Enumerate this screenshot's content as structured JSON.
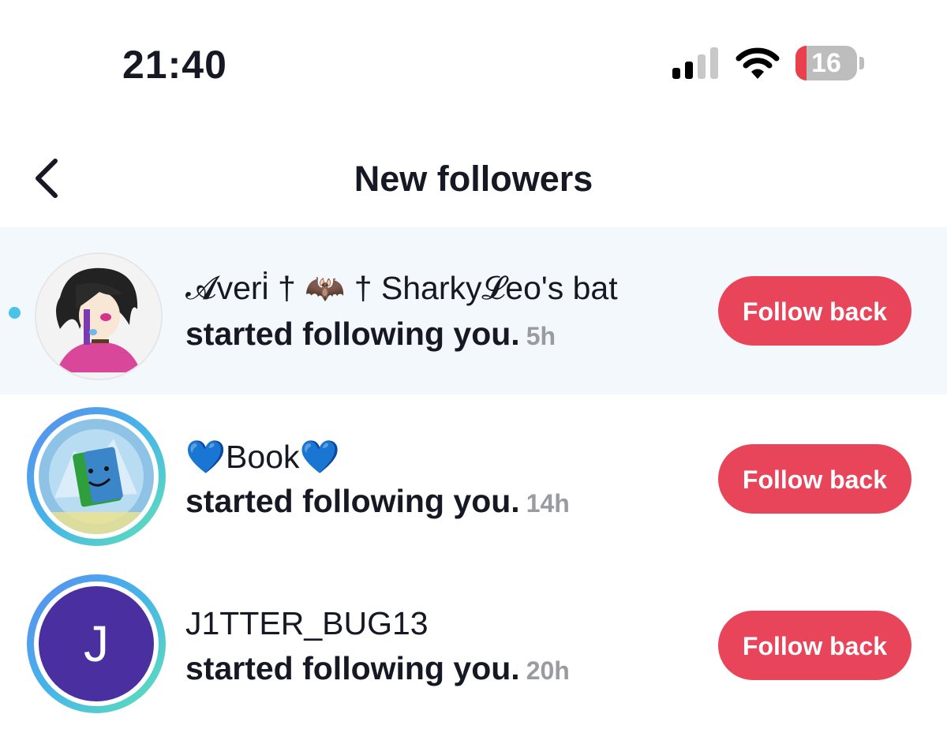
{
  "status_bar": {
    "time": "21:40",
    "battery_level": "16",
    "signal_bars_active": 2,
    "signal_bars_total": 4,
    "icons": [
      "signal-icon",
      "wifi-icon",
      "battery-icon"
    ]
  },
  "header": {
    "title": "New followers",
    "back_icon": "chevron-left-icon"
  },
  "colors": {
    "follow_button": "#e9455a",
    "unread_background": "#f2f8fb",
    "unread_dot": "#4bc3e8",
    "timestamp": "#9a9ba0",
    "avatar_letter_bg": "#4a2fa0"
  },
  "followers": [
    {
      "name": "𝓐veri̇ † 🦇 † Sharky𝓛eo's bat",
      "activity": "started following you.",
      "time": "5h",
      "button_label": "Follow back",
      "unread": true,
      "avatar": "anime-character-avatar"
    },
    {
      "name": "💙Book💙",
      "activity": "started following you.",
      "time": "14h",
      "button_label": "Follow back",
      "unread": false,
      "avatar": "book-character-avatar"
    },
    {
      "name": "J1TTER_BUG13",
      "activity": "started following you.",
      "time": "20h",
      "button_label": "Follow back",
      "unread": false,
      "avatar_letter": "J"
    }
  ]
}
